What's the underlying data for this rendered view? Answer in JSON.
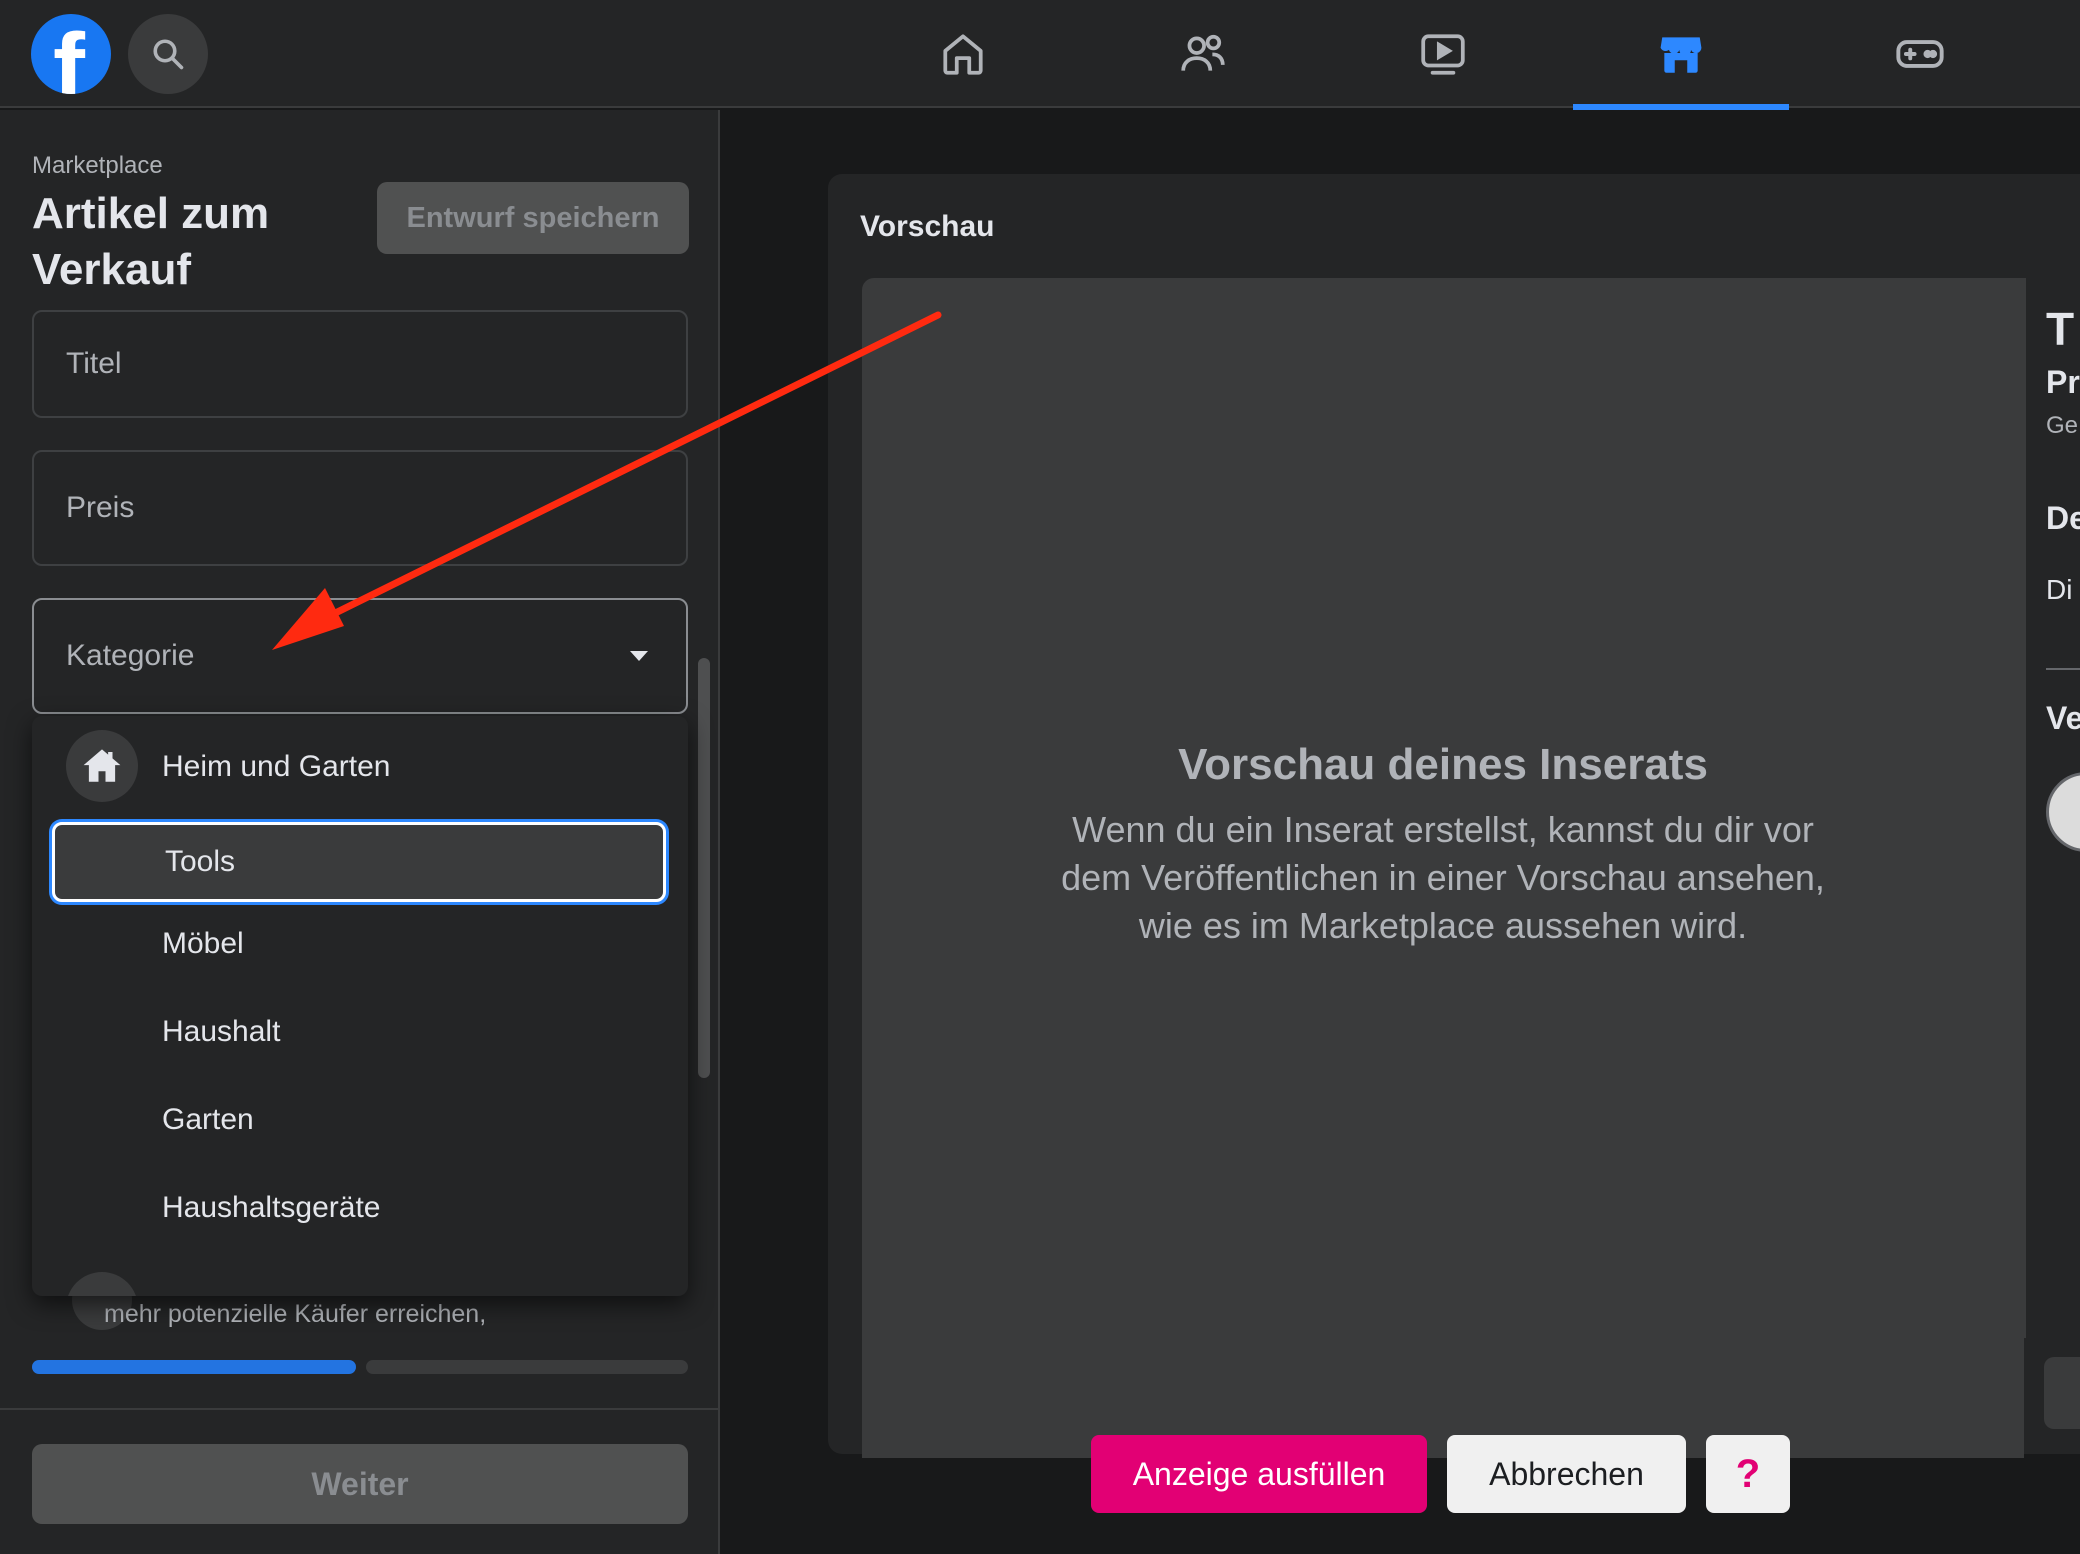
{
  "topbar": {
    "logo": "facebook-logo",
    "logo_letter": "f",
    "search_icon": "search-icon",
    "tabs": [
      {
        "name": "home",
        "icon": "home-icon",
        "active": false
      },
      {
        "name": "friends",
        "icon": "friends-icon",
        "active": false
      },
      {
        "name": "watch",
        "icon": "video-icon",
        "active": false
      },
      {
        "name": "marketplace",
        "icon": "marketplace-icon",
        "active": true
      },
      {
        "name": "gaming",
        "icon": "gamepad-icon",
        "active": false
      }
    ]
  },
  "left": {
    "breadcrumb": "Marketplace",
    "title": "Artikel zum Verkauf",
    "draft_button": "Entwurf speichern",
    "fields": {
      "title_placeholder": "Titel",
      "price_placeholder": "Preis",
      "category_placeholder": "Kategorie"
    },
    "dropdown": {
      "group_label": "Heim und Garten",
      "group_icon": "house-icon",
      "items": [
        "Tools",
        "Möbel",
        "Haushalt",
        "Garten",
        "Haushaltsgeräte"
      ],
      "selected_index": 0
    },
    "hint_text": "mehr potenzielle Käufer erreichen,",
    "progress_steps_done": 1,
    "progress_steps_total": 2,
    "next_button": "Weiter"
  },
  "preview": {
    "label": "Vorschau",
    "title": "Vorschau deines Inserats",
    "body": "Wenn du ein Inserat erstellst, kannst du dir vor dem Veröffentlichen in einer Vorschau ansehen, wie es im Marketplace aussehen wird.",
    "side_fragments": [
      "T",
      "Pr",
      "Ge",
      "De",
      "Di",
      "Ve"
    ]
  },
  "overlay": {
    "primary": "Anzeige ausfüllen",
    "secondary": "Abbrechen",
    "help": "?"
  },
  "colors": {
    "accent_blue": "#2d88ff",
    "annotation_arrow": "#ff2a10",
    "overlay_pink": "#e20074"
  }
}
